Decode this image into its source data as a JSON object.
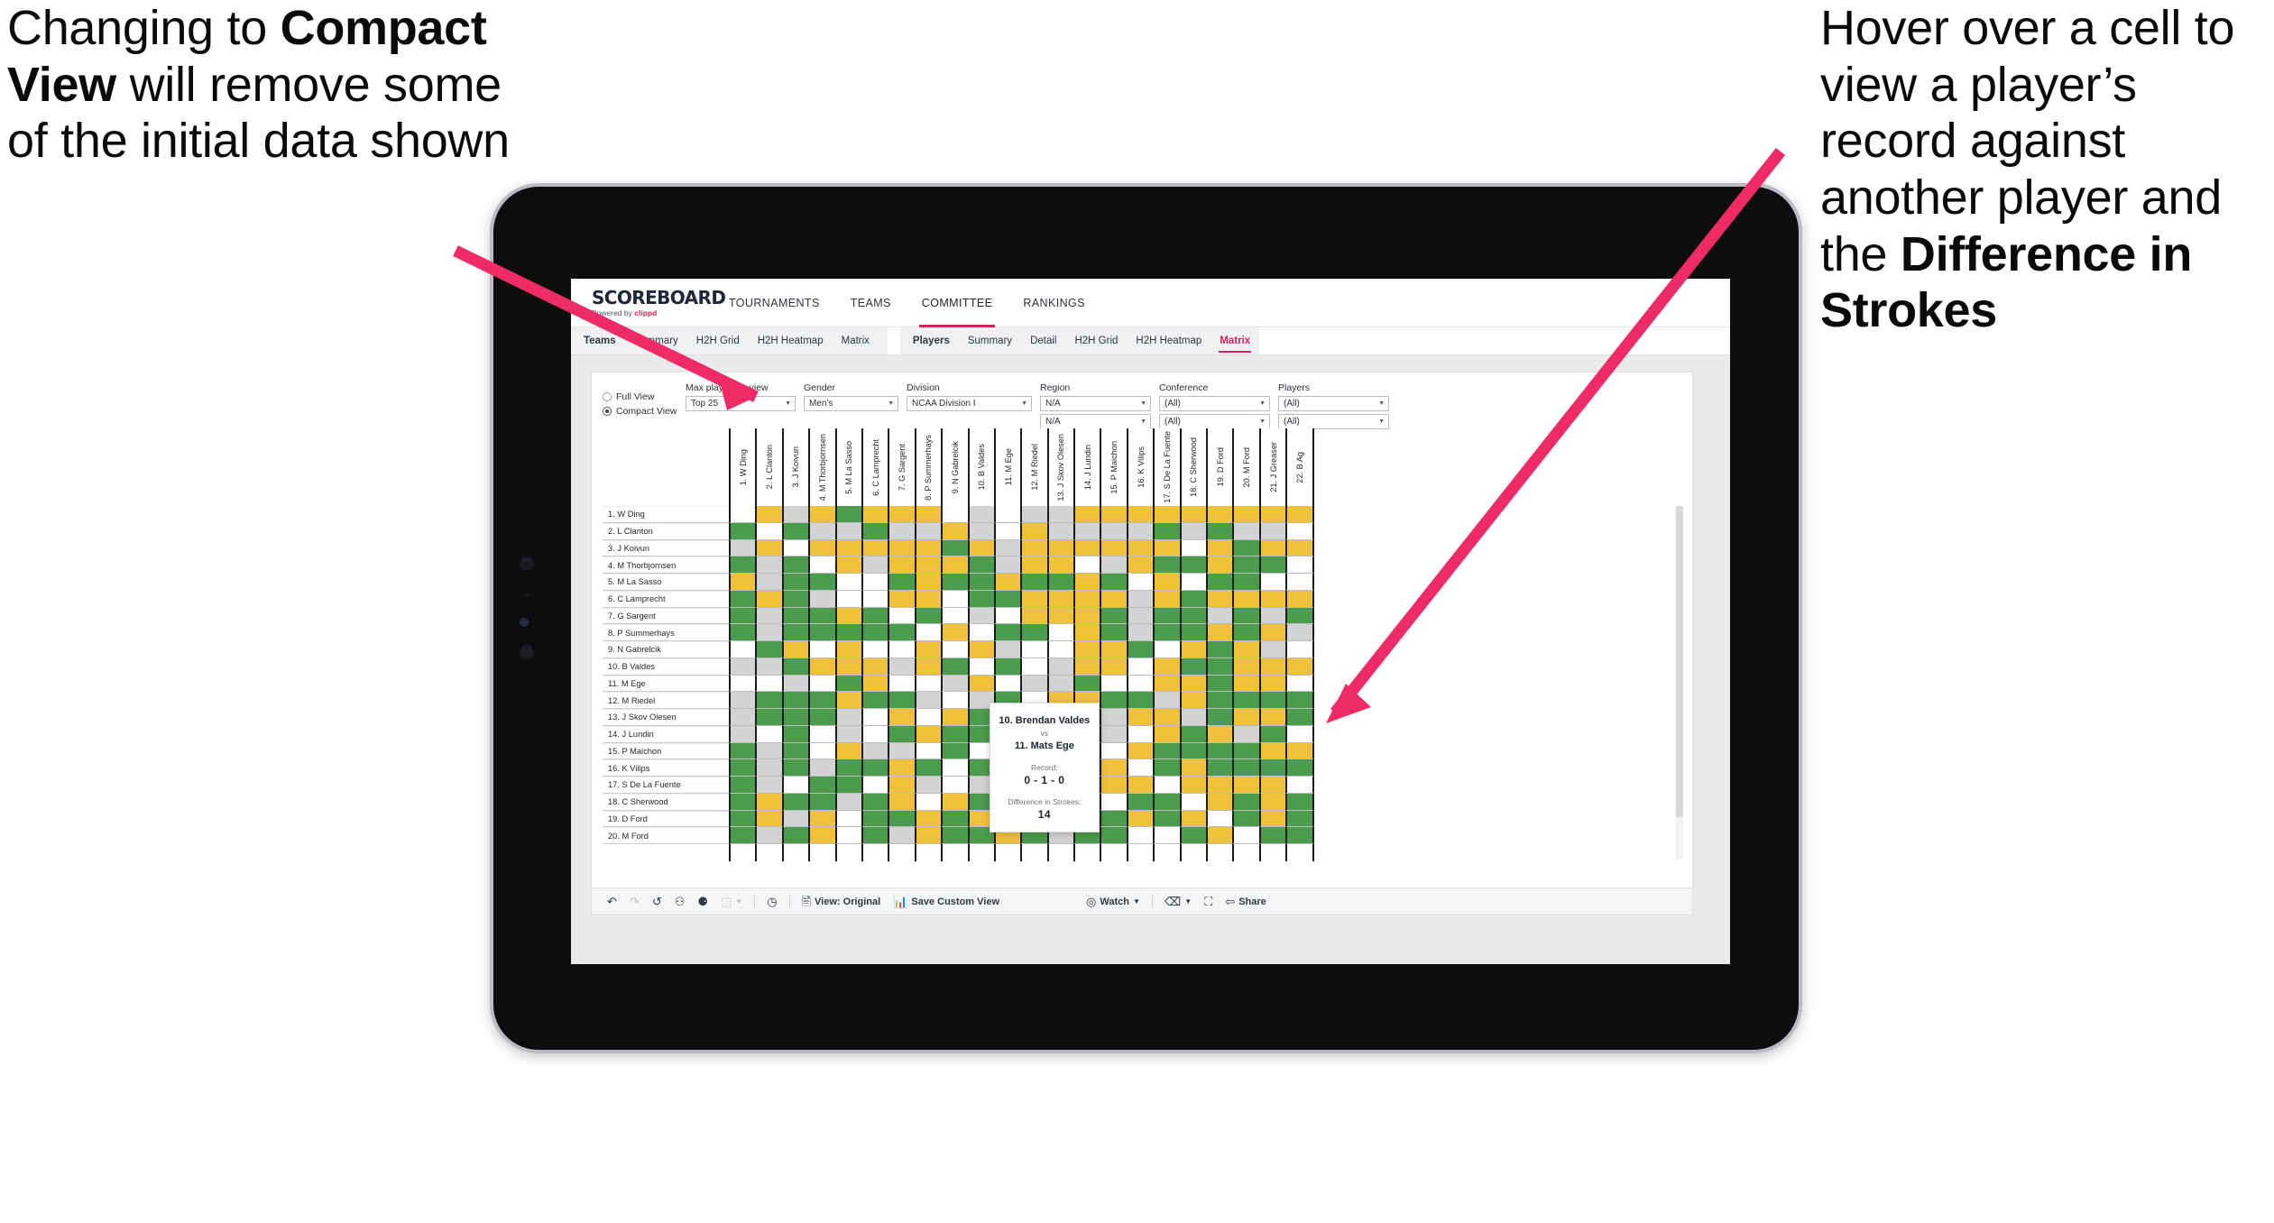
{
  "annotations": {
    "left": {
      "pre": "Changing to ",
      "bold": "Compact View",
      "post": " will remove some of the initial data shown"
    },
    "right": {
      "pre": "Hover over a cell to view a player’s record against another player and the ",
      "bold": "Difference in Strokes",
      "post": ""
    }
  },
  "app": {
    "logo": {
      "word": "SCOREBOARD",
      "sub_pre": "Powered by ",
      "sub_brand": "clippd"
    },
    "nav": [
      {
        "label": "TOURNAMENTS",
        "active": false
      },
      {
        "label": "TEAMS",
        "active": false
      },
      {
        "label": "COMMITTEE",
        "active": true
      },
      {
        "label": "RANKINGS",
        "active": false
      }
    ],
    "subtabs_teams": [
      {
        "label": "Teams",
        "head": true
      },
      {
        "label": "Summary"
      },
      {
        "label": "H2H Grid"
      },
      {
        "label": "H2H Heatmap"
      },
      {
        "label": "Matrix"
      }
    ],
    "subtabs_players": [
      {
        "label": "Players",
        "head": true
      },
      {
        "label": "Summary"
      },
      {
        "label": "Detail"
      },
      {
        "label": "H2H Grid"
      },
      {
        "label": "H2H Heatmap"
      },
      {
        "label": "Matrix",
        "selected": true
      }
    ]
  },
  "filters": {
    "view_options": [
      {
        "label": "Full View",
        "selected": false
      },
      {
        "label": "Compact View",
        "selected": true
      }
    ],
    "selects": [
      {
        "name": "max-players-in-view",
        "label": "Max players in view",
        "value": "Top 25",
        "width": "w-mp"
      },
      {
        "name": "gender",
        "label": "Gender",
        "value": "Men's",
        "width": "w-gn"
      },
      {
        "name": "division",
        "label": "Division",
        "value": "NCAA Division I",
        "width": "w-dv"
      },
      {
        "name": "region",
        "label": "Region",
        "value": "N/A",
        "value2": "N/A",
        "width": "w-rg"
      },
      {
        "name": "conference",
        "label": "Conference",
        "value": "(All)",
        "value2": "(All)",
        "width": "w-cf"
      },
      {
        "name": "players",
        "label": "Players",
        "value": "(All)",
        "value2": "(All)",
        "width": "w-pl"
      }
    ]
  },
  "matrix": {
    "row_labels": [
      "1. W Ding",
      "2. L Clanton",
      "3. J Koivun",
      "4. M Thorbjornsen",
      "5. M La Sasso",
      "6. C Lamprecht",
      "7. G Sargent",
      "8. P Summerhays",
      "9. N Gabrelcik",
      "10. B Valdes",
      "11. M Ege",
      "12. M Riedel",
      "13. J Skov Olesen",
      "14. J Lundin",
      "15. P Maichon",
      "16. K Vilips",
      "17. S De La Fuente",
      "18. C Sherwood",
      "19. D Ford",
      "20. M Ford"
    ],
    "col_labels": [
      "1. W Ding",
      "2. L Clanton",
      "3. J Koivun",
      "4. M Thorbjornsen",
      "5. M La Sasso",
      "6. C Lamprecht",
      "7. G Sargent",
      "8. P Summerhays",
      "9. N Gabrelcik",
      "10. B Valdes",
      "11. M Ege",
      "12. M Riedel",
      "13. J Skov Olesen",
      "14. J Lundin",
      "15. P Maichon",
      "16. K Vilips",
      "17. S De La Fuente",
      "18. C Sherwood",
      "19. D Ford",
      "20. M Ford",
      "21. J Greaser",
      "22. B Ag"
    ],
    "legend_colors": {
      "win": "#4c9c4d",
      "loss": "#f0c23c",
      "tie": "#d2d3d5",
      "none": "#ffffff"
    },
    "cells": [
      [
        "w",
        "y",
        "a",
        "y",
        "g",
        "y",
        "y",
        "y",
        "w",
        "a",
        "w",
        "a",
        "a",
        "y",
        "y",
        "y",
        "y",
        "y",
        "y",
        "y",
        "y",
        "y"
      ],
      [
        "g",
        "w",
        "g",
        "a",
        "a",
        "g",
        "a",
        "a",
        "y",
        "a",
        "w",
        "y",
        "a",
        "a",
        "a",
        "a",
        "g",
        "a",
        "g",
        "a",
        "a",
        "w"
      ],
      [
        "a",
        "y",
        "w",
        "y",
        "y",
        "y",
        "y",
        "y",
        "g",
        "y",
        "a",
        "y",
        "y",
        "y",
        "y",
        "y",
        "y",
        "w",
        "y",
        "g",
        "y",
        "y"
      ],
      [
        "g",
        "a",
        "g",
        "w",
        "y",
        "a",
        "y",
        "y",
        "y",
        "g",
        "a",
        "y",
        "y",
        "w",
        "a",
        "y",
        "g",
        "g",
        "y",
        "g",
        "g",
        "w"
      ],
      [
        "y",
        "a",
        "g",
        "g",
        "w",
        "w",
        "g",
        "y",
        "g",
        "g",
        "y",
        "g",
        "g",
        "y",
        "g",
        "w",
        "y",
        "w",
        "g",
        "g",
        "w",
        "w"
      ],
      [
        "g",
        "y",
        "g",
        "a",
        "w",
        "w",
        "y",
        "y",
        "w",
        "g",
        "g",
        "y",
        "y",
        "y",
        "y",
        "a",
        "y",
        "g",
        "y",
        "y",
        "y",
        "y"
      ],
      [
        "g",
        "a",
        "g",
        "g",
        "y",
        "g",
        "w",
        "g",
        "w",
        "a",
        "w",
        "y",
        "y",
        "y",
        "g",
        "a",
        "g",
        "g",
        "a",
        "g",
        "a",
        "g"
      ],
      [
        "g",
        "a",
        "g",
        "g",
        "g",
        "g",
        "g",
        "w",
        "y",
        "w",
        "g",
        "g",
        "w",
        "y",
        "g",
        "a",
        "g",
        "g",
        "y",
        "g",
        "y",
        "a"
      ],
      [
        "w",
        "g",
        "y",
        "w",
        "y",
        "w",
        "w",
        "y",
        "w",
        "y",
        "a",
        "w",
        "w",
        "y",
        "y",
        "g",
        "w",
        "y",
        "g",
        "y",
        "a",
        "w"
      ],
      [
        "a",
        "a",
        "g",
        "y",
        "y",
        "y",
        "a",
        "y",
        "g",
        "w",
        "g",
        "w",
        "a",
        "y",
        "y",
        "w",
        "y",
        "g",
        "g",
        "y",
        "y",
        "y"
      ],
      [
        "w",
        "w",
        "a",
        "w",
        "g",
        "y",
        "w",
        "w",
        "a",
        "y",
        "w",
        "a",
        "a",
        "g",
        "w",
        "w",
        "y",
        "y",
        "g",
        "y",
        "y",
        "w"
      ],
      [
        "a",
        "g",
        "g",
        "g",
        "y",
        "g",
        "g",
        "a",
        "w",
        "a",
        "g",
        "w",
        "y",
        "y",
        "g",
        "g",
        "a",
        "y",
        "g",
        "g",
        "g",
        "g"
      ],
      [
        "a",
        "g",
        "g",
        "g",
        "a",
        "w",
        "y",
        "w",
        "y",
        "g",
        "g",
        "y",
        "w",
        "y",
        "a",
        "y",
        "y",
        "a",
        "g",
        "y",
        "y",
        "g"
      ],
      [
        "a",
        "w",
        "g",
        "w",
        "a",
        "w",
        "g",
        "y",
        "g",
        "g",
        "g",
        "y",
        "y",
        "w",
        "a",
        "w",
        "y",
        "g",
        "y",
        "a",
        "g",
        "w"
      ],
      [
        "g",
        "a",
        "g",
        "w",
        "y",
        "a",
        "a",
        "w",
        "g",
        "w",
        "y",
        "g",
        "y",
        "w",
        "w",
        "y",
        "g",
        "g",
        "g",
        "g",
        "y",
        "y"
      ],
      [
        "g",
        "a",
        "g",
        "a",
        "g",
        "g",
        "y",
        "g",
        "w",
        "g",
        "a",
        "g",
        "g",
        "w",
        "y",
        "w",
        "g",
        "y",
        "g",
        "g",
        "g",
        "g"
      ],
      [
        "g",
        "a",
        "w",
        "g",
        "g",
        "w",
        "y",
        "a",
        "w",
        "a",
        "w",
        "g",
        "y",
        "w",
        "y",
        "y",
        "w",
        "y",
        "y",
        "y",
        "y",
        "w"
      ],
      [
        "g",
        "y",
        "g",
        "g",
        "a",
        "g",
        "y",
        "w",
        "y",
        "g",
        "y",
        "y",
        "g",
        "g",
        "w",
        "g",
        "g",
        "w",
        "y",
        "g",
        "y",
        "g"
      ],
      [
        "g",
        "y",
        "a",
        "y",
        "w",
        "g",
        "g",
        "y",
        "g",
        "y",
        "a",
        "g",
        "w",
        "a",
        "g",
        "y",
        "g",
        "y",
        "w",
        "g",
        "y",
        "g"
      ],
      [
        "g",
        "a",
        "g",
        "y",
        "w",
        "g",
        "a",
        "y",
        "g",
        "g",
        "y",
        "g",
        "a",
        "g",
        "g",
        "w",
        "w",
        "g",
        "y",
        "w",
        "g",
        "g"
      ]
    ]
  },
  "tooltip": {
    "player_a": "10. Brendan Valdes",
    "vs": "vs",
    "player_b": "11. Mats Ege",
    "record_label": "Record:",
    "record_value": "0 - 1 - 0",
    "strokes_label": "Difference in Strokes:",
    "strokes_value": "14"
  },
  "toolbar": {
    "icons": [
      {
        "name": "undo-icon",
        "glyph": "↶",
        "dim": false
      },
      {
        "name": "redo-icon",
        "glyph": "↷",
        "dim": true
      },
      {
        "name": "revert-icon",
        "glyph": "↺",
        "dim": false
      },
      {
        "name": "refresh-data-icon",
        "glyph": "⚇",
        "dim": false
      },
      {
        "name": "pause-updates-icon",
        "glyph": "⚈",
        "dim": false
      },
      {
        "name": "highlight-icon",
        "glyph": "⬚",
        "dim": true
      }
    ],
    "clock_icon": "◷",
    "view_original": "View: Original",
    "save_custom_view": "Save Custom View",
    "watch": "Watch",
    "share": "Share"
  }
}
